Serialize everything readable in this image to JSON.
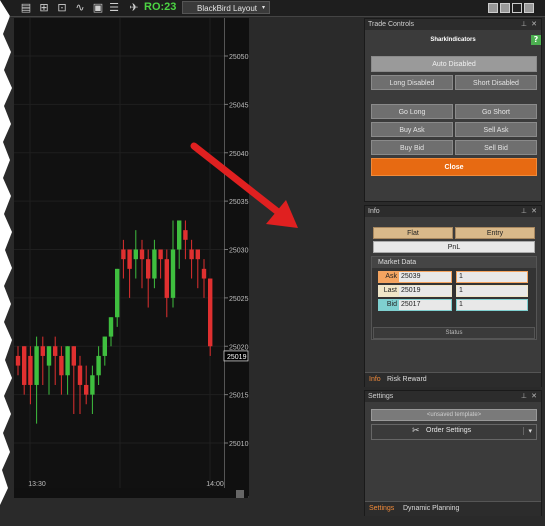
{
  "toolbar": {
    "ro_label": "RO:23",
    "layout_label": "BlackBird Layout",
    "icons": [
      "chart-icon",
      "chart-style-icon",
      "zoom-icon",
      "drawing-icon",
      "properties-icon",
      "list-icon",
      "shark-icon"
    ]
  },
  "chart": {
    "price_ticks": [
      "25050",
      "25045",
      "25040",
      "25035",
      "25030",
      "25025",
      "25020",
      "25015",
      "25010"
    ],
    "current_price": "25019",
    "time_ticks": [
      "13:30",
      "14:00"
    ]
  },
  "trade_controls": {
    "title": "Trade Controls",
    "brand": "SharkIndicators",
    "auto_label": "Auto Disabled",
    "long_disabled": "Long Disabled",
    "short_disabled": "Short Disabled",
    "go_long": "Go Long",
    "go_short": "Go Short",
    "buy_ask": "Buy Ask",
    "sell_ask": "Sell Ask",
    "buy_bid": "Buy Bid",
    "sell_bid": "Sell Bid",
    "close": "Close"
  },
  "info": {
    "title": "Info",
    "flat": "Flat",
    "entry": "Entry",
    "pnl": "PnL",
    "market_data_title": "Market Data",
    "rows": [
      {
        "label": "Ask",
        "value": "25039",
        "qty": "1",
        "color": "#f4a460"
      },
      {
        "label": "Last",
        "value": "25019",
        "qty": "1",
        "color": "#f0e6c8"
      },
      {
        "label": "Bid",
        "value": "25017",
        "qty": "1",
        "color": "#7fd0d0"
      }
    ],
    "status": "Status",
    "tabs": [
      "Info",
      "Risk Reward"
    ]
  },
  "settings": {
    "title": "Settings",
    "template_placeholder": "<unsaved template>",
    "order_settings": "Order Settings",
    "tabs": [
      "Settings",
      "Dynamic Planning"
    ]
  },
  "colors": {
    "up": "#3fbf3f",
    "down": "#e03030",
    "accent": "#e76a12",
    "ro": "#4cd443"
  }
}
